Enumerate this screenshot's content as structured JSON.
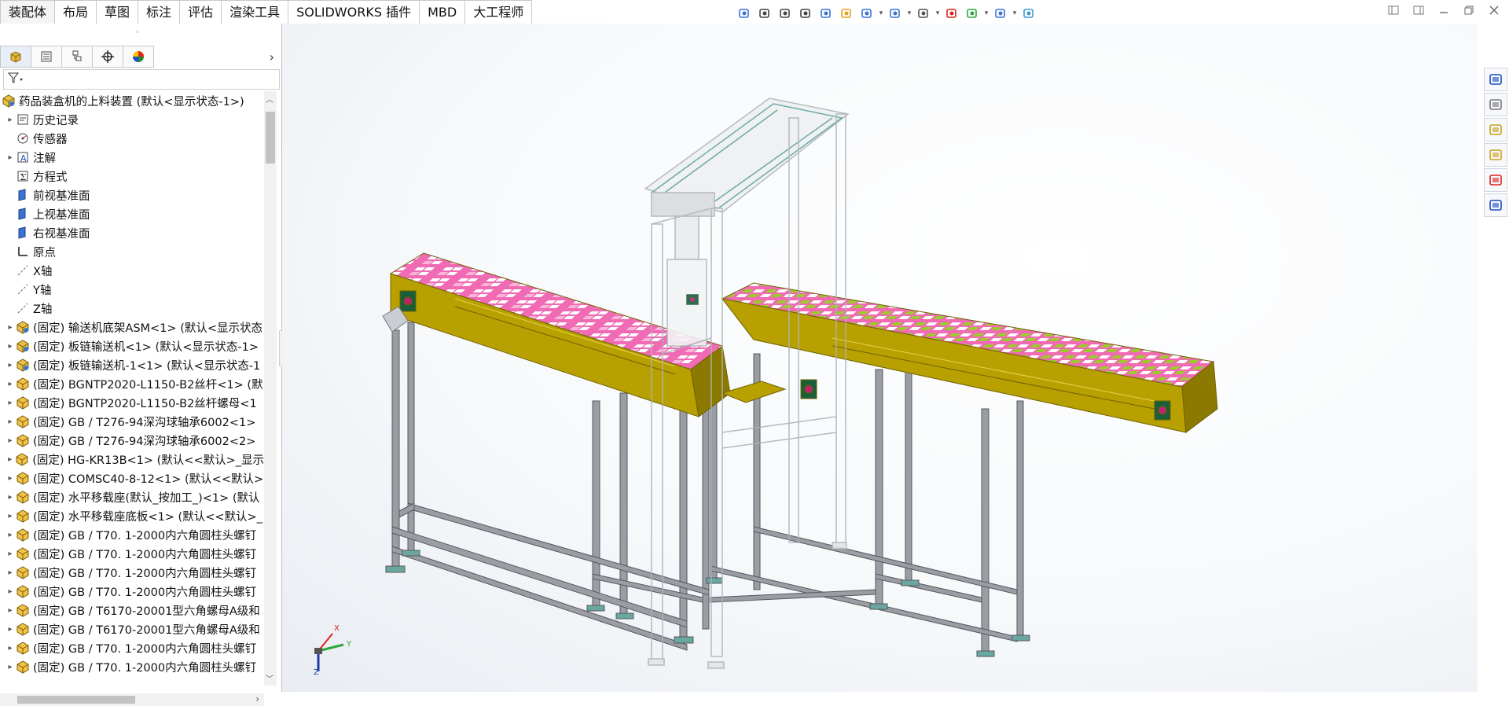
{
  "tabs": [
    "装配体",
    "布局",
    "草图",
    "标注",
    "评估",
    "渲染工具",
    "SOLIDWORKS 插件",
    "MBD",
    "大工程师"
  ],
  "hud_icons": [
    "view-orient-icon",
    "zoom-to-fit-icon",
    "zoom-area-icon",
    "previous-view-icon",
    "section-view-icon",
    "dynamic-annotation-icon",
    "view-settings-icon",
    "display-style-icon",
    "hide-show-icon",
    "edit-appearance-icon",
    "apply-scene-icon",
    "view-display-icon",
    "standard-views-icon"
  ],
  "window_controls": [
    "collapse-left-icon",
    "collapse-right-icon",
    "minimize-icon",
    "restore-icon",
    "close-icon"
  ],
  "panel": {
    "tab_icons": [
      "feature-manager-icon",
      "property-manager-icon",
      "configuration-manager-icon",
      "dimxpert-icon",
      "display-manager-icon"
    ],
    "filter_icon": "filter-icon",
    "root": "药品装盒机的上料装置 (默认<显示状态-1>)",
    "items": [
      {
        "label": "历史记录",
        "icon": "history-icon",
        "expand": true
      },
      {
        "label": "传感器",
        "icon": "sensor-icon",
        "expand": false
      },
      {
        "label": "注解",
        "icon": "annotation-icon",
        "expand": true
      },
      {
        "label": "方程式",
        "icon": "equation-icon",
        "expand": false
      },
      {
        "label": "前视基准面",
        "icon": "plane-icon",
        "expand": false
      },
      {
        "label": "上视基准面",
        "icon": "plane-icon",
        "expand": false
      },
      {
        "label": "右视基准面",
        "icon": "plane-icon",
        "expand": false
      },
      {
        "label": "原点",
        "icon": "origin-icon",
        "expand": false
      },
      {
        "label": "X轴",
        "icon": "axis-icon",
        "expand": false
      },
      {
        "label": "Y轴",
        "icon": "axis-icon",
        "expand": false
      },
      {
        "label": "Z轴",
        "icon": "axis-icon",
        "expand": false
      },
      {
        "label": "(固定) 输送机底架ASM<1> (默认<显示状态",
        "icon": "subassembly-icon",
        "expand": true
      },
      {
        "label": "(固定) 板链输送机<1> (默认<显示状态-1>",
        "icon": "subassembly-icon",
        "expand": true
      },
      {
        "label": "(固定) 板链输送机-1<1> (默认<显示状态-1",
        "icon": "subassembly-icon",
        "expand": true
      },
      {
        "label": "(固定) BGNTP2020-L1150-B2丝杆<1> (默",
        "icon": "part-icon",
        "expand": true
      },
      {
        "label": "(固定) BGNTP2020-L1150-B2丝杆螺母<1",
        "icon": "part-icon",
        "expand": true
      },
      {
        "label": "(固定) GB / T276-94深沟球轴承6002<1>",
        "icon": "part-icon",
        "expand": true
      },
      {
        "label": "(固定) GB / T276-94深沟球轴承6002<2>",
        "icon": "part-icon",
        "expand": true
      },
      {
        "label": "(固定) HG-KR13B<1> (默认<<默认>_显示",
        "icon": "part-icon",
        "expand": true
      },
      {
        "label": "(固定) COMSC40-8-12<1> (默认<<默认>",
        "icon": "part-icon",
        "expand": true
      },
      {
        "label": "(固定) 水平移载座(默认_按加工_)<1> (默认",
        "icon": "part-icon",
        "expand": true
      },
      {
        "label": "(固定) 水平移载座底板<1> (默认<<默认>_",
        "icon": "part-icon",
        "expand": true
      },
      {
        "label": "(固定) GB / T70. 1-2000内六角圆柱头螺钉",
        "icon": "part-icon",
        "expand": true
      },
      {
        "label": "(固定) GB / T70. 1-2000内六角圆柱头螺钉",
        "icon": "part-icon",
        "expand": true
      },
      {
        "label": "(固定) GB / T70. 1-2000内六角圆柱头螺钉",
        "icon": "part-icon",
        "expand": true
      },
      {
        "label": "(固定) GB / T70. 1-2000内六角圆柱头螺钉",
        "icon": "part-icon",
        "expand": true
      },
      {
        "label": "(固定) GB / T6170-20001型六角螺母A级和",
        "icon": "part-icon",
        "expand": true
      },
      {
        "label": "(固定) GB / T6170-20001型六角螺母A级和",
        "icon": "part-icon",
        "expand": true
      },
      {
        "label": "(固定) GB / T70. 1-2000内六角圆柱头螺钉",
        "icon": "part-icon",
        "expand": true
      },
      {
        "label": "(固定) GB / T70. 1-2000内六角圆柱头螺钉",
        "icon": "part-icon",
        "expand": true
      }
    ]
  },
  "triad": {
    "x": "X",
    "y": "Y",
    "z": "Z"
  },
  "taskpane_icons": [
    "solidworks-resources-icon",
    "design-library-icon",
    "file-explorer-icon",
    "view-palette-icon",
    "appearances-icon",
    "custom-properties-icon"
  ],
  "colors": {
    "conveyor": "#b8a000",
    "conveyor_dark": "#6e6100",
    "chain_pink": "#f06ab4",
    "tray_green": "#9ccc2a",
    "frame": "#9a9ea4",
    "frame_dark": "#55595e",
    "ghost": "#c9cdd2",
    "accent": "#1f5fbf"
  }
}
